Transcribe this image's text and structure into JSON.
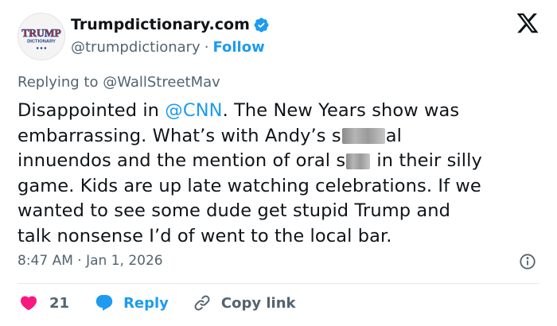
{
  "account": {
    "display_name": "Trumpdictionary.com",
    "handle": "@trumpdictionary",
    "separator": "·",
    "follow_label": "Follow",
    "avatar_logo_text_top": "TRUMP",
    "avatar_logo_text_bottom": "DICTIONARY",
    "verified_color": "#1d9bf0"
  },
  "header": {
    "platform_icon": "x-logo-icon"
  },
  "reply": {
    "prefix": "Replying to ",
    "mention": "@WallStreetMav"
  },
  "tweet": {
    "l1_a": "Disappointed in ",
    "l1_link": "@CNN",
    "l1_b": ". The New Years show was",
    "l2_a": "embarrassing. What’s with Andy’s s",
    "l2_b": "al",
    "l3_a": "innuendos and the mention of oral s",
    "l3_b": " in their silly",
    "l4": "game. Kids are up late watching celebrations. If we",
    "l5": "wanted to see some dude get stupid Trump and",
    "l6": "talk nonsense I’d of went to the local bar."
  },
  "meta": {
    "timestamp": "8:47 AM · Jan 1, 2026",
    "info_icon": "info-icon"
  },
  "actions": {
    "like_count": "21",
    "reply_label": "Reply",
    "copy_label": "Copy link",
    "like_color": "#f91880",
    "reply_color": "#1d9bf0"
  }
}
